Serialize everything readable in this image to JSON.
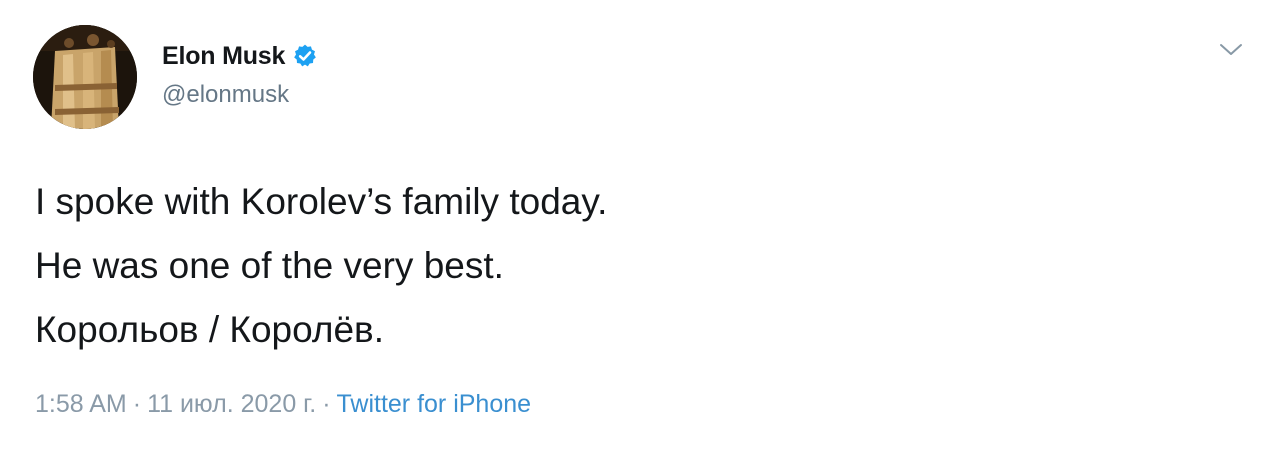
{
  "author": {
    "display_name": "Elon Musk",
    "handle": "@elonmusk",
    "verified": true,
    "avatar": "profile-photo"
  },
  "tweet": {
    "lines": [
      "I spoke with Korolev’s family today.",
      "He was one of the very best.",
      "Корольов / Королёв."
    ]
  },
  "meta": {
    "time": "1:58 AM",
    "separator": "·",
    "date": "11 июл. 2020 г.",
    "source": "Twitter for iPhone"
  },
  "icons": {
    "verified": "verified-badge-icon",
    "caret": "chevron-down-icon"
  },
  "colors": {
    "text": "#14171a",
    "secondary": "#657786",
    "meta": "#8a9aa8",
    "accent": "#1da1f2",
    "link": "#3a8fd0"
  }
}
